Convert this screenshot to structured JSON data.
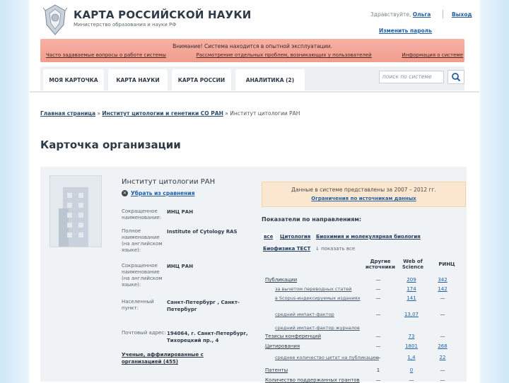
{
  "header": {
    "title": "КАРТА РОССИЙСКОЙ НАУКИ",
    "subtitle": "Министерство образования и науки РФ",
    "greeting": "Здравствуйте,",
    "user": "Ольга",
    "logout": "Выход",
    "change_password": "Изменить пароль"
  },
  "alert": {
    "message": "Внимание! Система находится в опытной эксплуатации.",
    "links": [
      "Часто задаваемые вопросы о работе системы",
      "Рассмотрение отдельных проблем, возникающих у пользователей",
      "Информация о системе"
    ]
  },
  "nav": {
    "tabs": [
      "МОЯ КАРТОЧКА",
      "КАРТА НАУКИ",
      "КАРТА РОССИИ",
      "АНАЛИТИКА (2)"
    ],
    "search_placeholder": "поиск по системе"
  },
  "breadcrumb": {
    "home": "Главная страница",
    "sep": "»",
    "parent": "Институт цитологии и генетики СО РАН",
    "current": "Институт цитологии РАН"
  },
  "page_title": "Карточка организации",
  "org": {
    "name": "Институт цитологии РАН",
    "remove_link": "Убрать из сравнения",
    "fields": [
      {
        "label": "Сокращенное наименование:",
        "value": "ИНЦ РАН"
      },
      {
        "label": "Полное наименование (на английском языке):",
        "value": "Institute of Cytology RAS"
      },
      {
        "label": "Сокращенное наименование (на английском языке):",
        "value": "ИНЦ РАН"
      },
      {
        "label": "Населенный пункт:",
        "value": "Санкт-Петербург , Санкт-Петербург"
      },
      {
        "label": "Почтовый адрес:",
        "value": "194064, г. Санкт-Петербург, Тихорецкий пр., 4"
      }
    ],
    "affiliated": "Ученые, аффилированные с организацией (455)"
  },
  "info": {
    "period": "Данные в системе представлены за 2007 – 2012 гг.",
    "restrictions_link": "Ограничения по источникам данных"
  },
  "indicators": {
    "heading": "Показатели по направлениям:",
    "chips": [
      "все",
      "Цитология",
      "Биохимия и молекулярная биология",
      "Биофизика ТЕСТ"
    ],
    "show_all": "показать все",
    "columns": [
      "Другие источники",
      "Web of Science",
      "РИНЦ"
    ],
    "rows": [
      {
        "name": "Публикации",
        "c1": "—",
        "c2": "209",
        "c3": "342",
        "sub": false
      },
      {
        "name": "за вычетом переводных статей",
        "c1": "—",
        "c2": "174",
        "c3": "142",
        "sub": true
      },
      {
        "name": "в Scopus-индексируемых изданиях",
        "c1": "—",
        "c2": "141",
        "c3": "—",
        "sub": true
      },
      {
        "name": "средний импакт-фактор",
        "c1": "—",
        "c2": "13,07",
        "c3": "—",
        "sub": true
      },
      {
        "name": "средний импакт-фактор журналов",
        "c1": "",
        "c2": "",
        "c3": "",
        "sub": true
      },
      {
        "name": "Тезисы конференций",
        "c1": "—",
        "c2": "73",
        "c3": "—",
        "sub": false
      },
      {
        "name": "Цитирования",
        "c1": "—",
        "c2": "1801",
        "c3": "268",
        "sub": false
      },
      {
        "name": "среднее количество цитат на публикацию",
        "c1": "—",
        "c2": "1,4",
        "c3": "22",
        "sub": true
      },
      {
        "name": "Патенты",
        "c1": "1",
        "c2": "0",
        "c3": "—",
        "sub": false
      },
      {
        "name": "Количество поддержанных грантов",
        "c1": "—",
        "c2": "—",
        "c3": "—",
        "sub": false
      }
    ]
  },
  "colors": {
    "accent": "#1f5fa5",
    "alert": "#f3a796",
    "info": "#fbe7cf",
    "card": "#f0f3f6"
  }
}
